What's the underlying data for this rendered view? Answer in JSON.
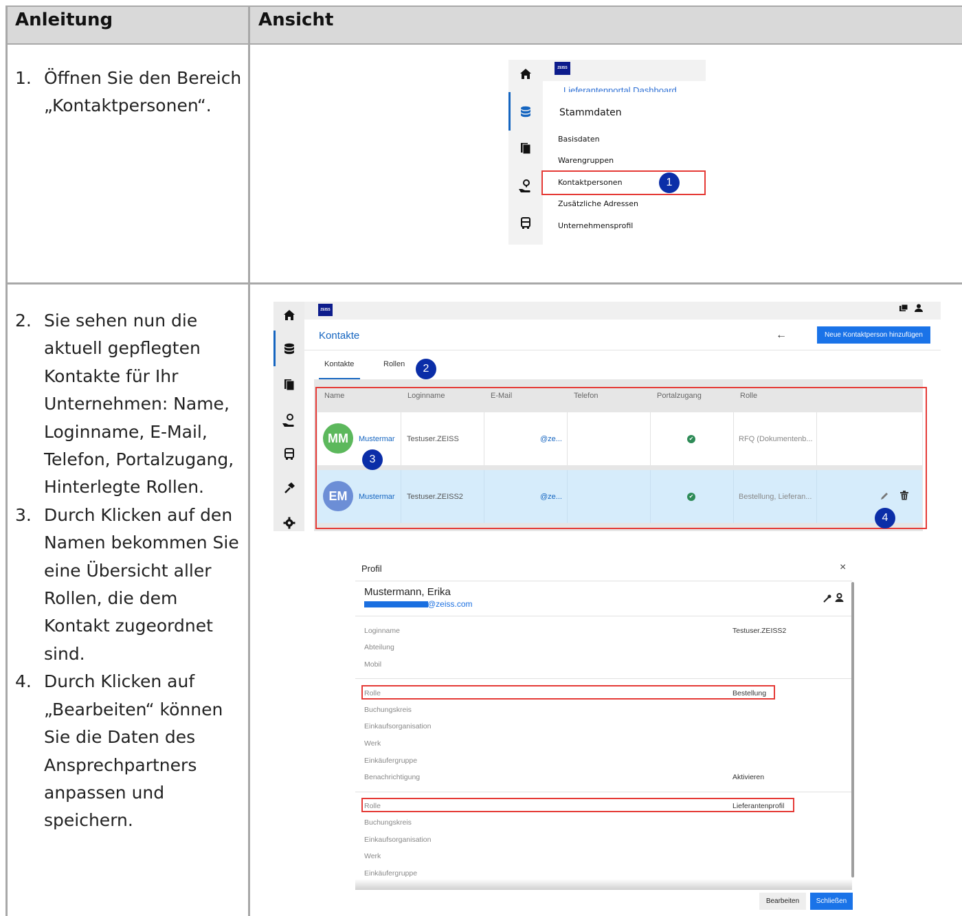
{
  "table": {
    "header_left": "Anleitung",
    "header_right": "Ansicht"
  },
  "instructions": {
    "step1": {
      "num": "1.",
      "line1": "Öffnen Sie den Bereich",
      "line2": "„Kontaktpersonen“."
    },
    "step2": {
      "num": "2.",
      "lines": [
        "Sie sehen nun die",
        "aktuell gepflegten",
        "Kontakte für Ihr",
        "Unternehmen: Name,",
        "Loginname, E-Mail,",
        "Telefon, Portalzugang,",
        "Hinterlegte Rollen."
      ]
    },
    "step3": {
      "num": "3.",
      "lines": [
        "Durch Klicken auf den",
        "Namen bekommen Sie",
        "eine Übersicht aller",
        "Rollen, die dem",
        "Kontakt zugeordnet",
        "sind."
      ]
    },
    "step4": {
      "num": "4.",
      "lines": [
        "Durch Klicken auf",
        "„Bearbeiten“ können",
        "Sie die Daten des",
        "Ansprechpartners",
        "anpassen und",
        "speichern."
      ]
    }
  },
  "menu_screenshot": {
    "logo": "ZEISS",
    "cut_off_text": "Lieferantenportal Dashboard",
    "section_title": "Stammdaten",
    "items": [
      "Basisdaten",
      "Warengruppen",
      "Kontaktpersonen",
      "Zusätzliche Adressen",
      "Unternehmensprofil"
    ],
    "badge": "1",
    "rail_icons": [
      "home-icon",
      "database-icon",
      "documents-icon",
      "support-icon",
      "truck-icon"
    ]
  },
  "contacts_screenshot": {
    "logo": "ZEISS",
    "title": "Kontakte",
    "back_arrow": "←",
    "new_button": "Neue Kontaktperson hinzufügen",
    "tabs": [
      "Kontakte",
      "Rollen"
    ],
    "badge_tabs": "2",
    "columns": [
      "Name",
      "Loginname",
      "E-Mail",
      "Telefon",
      "Portalzugang",
      "Rolle"
    ],
    "rows": [
      {
        "initials": "MM",
        "avatar_color": "#5cb85c",
        "name": "Mustermar",
        "login": "Testuser.ZEISS",
        "email": "@ze...",
        "phone": "",
        "portal": "✔",
        "role": "RFQ (Dokumentenb..."
      },
      {
        "initials": "EM",
        "avatar_color": "#6c8ed6",
        "name": "Mustermar",
        "login": "Testuser.ZEISS2",
        "email": "@ze...",
        "phone": "",
        "portal": "✔",
        "role": "Bestellung, Lieferan..."
      }
    ],
    "badge_name": "3",
    "badge_edit": "4",
    "rail_icons": [
      "home-icon",
      "database-icon",
      "documents-icon",
      "support-icon",
      "truck-icon",
      "hammer-icon",
      "gear-icon"
    ],
    "colors": {
      "accent": "#1565c0",
      "selected_row": "#d6ecfb",
      "highlight": "#e53935"
    }
  },
  "profile_screenshot": {
    "title": "Profil",
    "close": "×",
    "name": "Mustermann, Erika",
    "email_suffix": "@zeiss.com",
    "fields_top": [
      {
        "label": "Loginname",
        "value": "Testuser.ZEISS2"
      },
      {
        "label": "Abteilung",
        "value": ""
      },
      {
        "label": "Mobil",
        "value": ""
      }
    ],
    "block1": [
      {
        "label": "Rolle",
        "value": "Bestellung"
      },
      {
        "label": "Buchungskreis",
        "value": ""
      },
      {
        "label": "Einkaufsorganisation",
        "value": ""
      },
      {
        "label": "Werk",
        "value": ""
      },
      {
        "label": "Einkäufergruppe",
        "value": ""
      },
      {
        "label": "Benachrichtigung",
        "value": "Aktivieren"
      }
    ],
    "block2": [
      {
        "label": "Rolle",
        "value": "Lieferantenprofil"
      },
      {
        "label": "Buchungskreis",
        "value": ""
      },
      {
        "label": "Einkaufsorganisation",
        "value": ""
      },
      {
        "label": "Werk",
        "value": ""
      },
      {
        "label": "Einkäufergruppe",
        "value": ""
      }
    ],
    "edit_button": "Bearbeiten",
    "close_button": "Schließen"
  }
}
